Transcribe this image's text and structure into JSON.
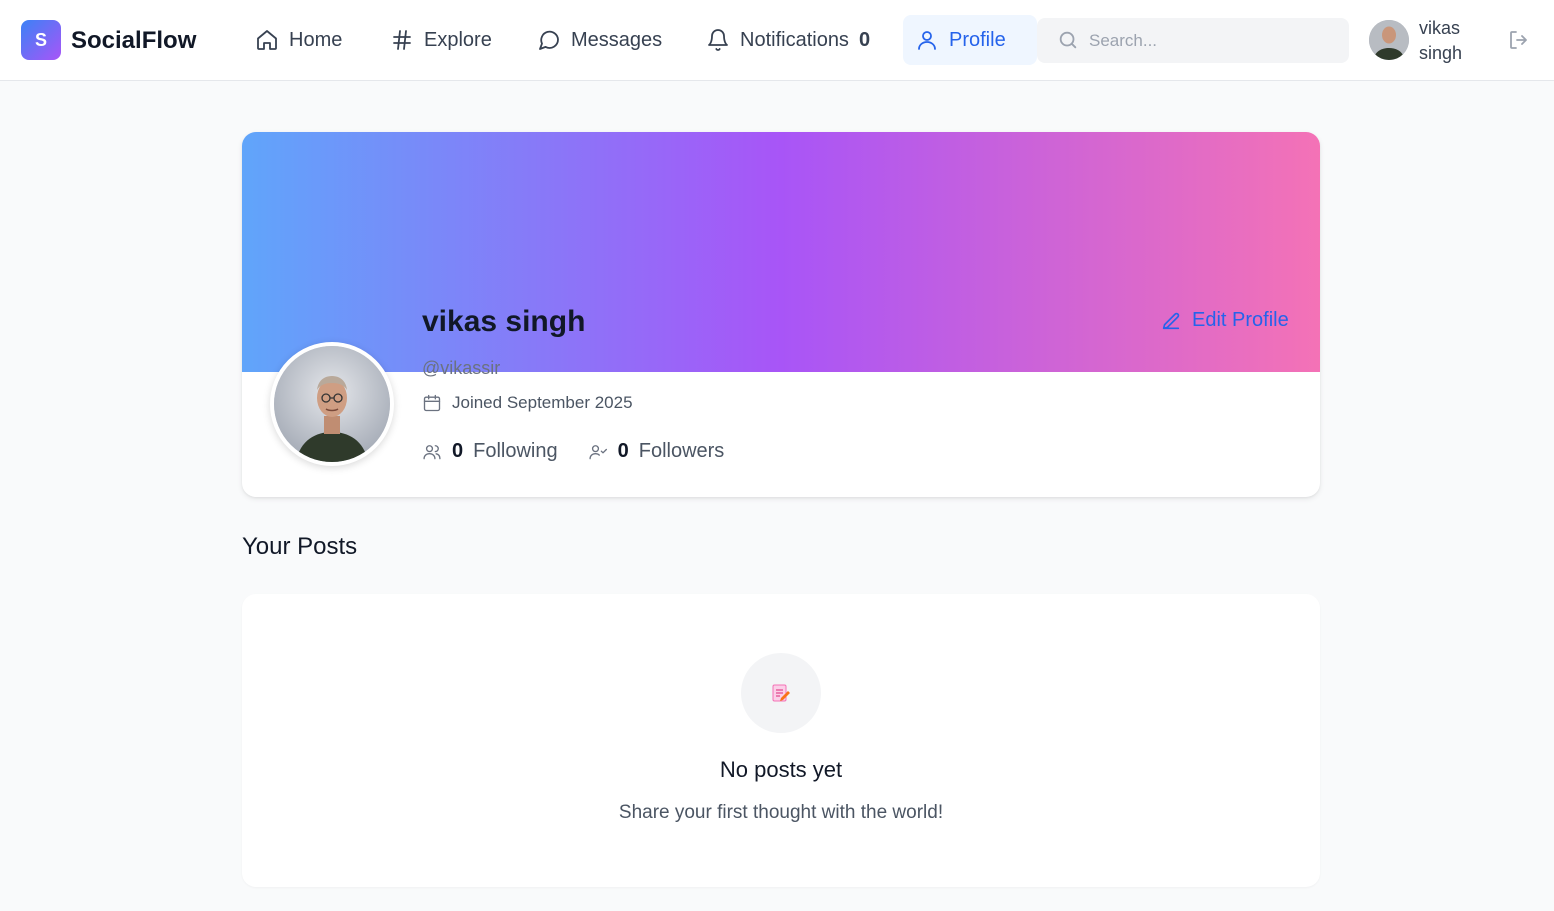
{
  "app": {
    "logo_letter": "S",
    "name": "SocialFlow"
  },
  "nav": {
    "items": [
      {
        "label": "Home",
        "icon": "home-icon"
      },
      {
        "label": "Explore",
        "icon": "hash-icon"
      },
      {
        "label": "Messages",
        "icon": "message-icon"
      },
      {
        "label": "Notifications",
        "icon": "bell-icon",
        "count": "0"
      },
      {
        "label": "Profile",
        "icon": "user-icon",
        "active": true
      }
    ]
  },
  "search": {
    "placeholder": "Search..."
  },
  "current_user": {
    "first": "vikas",
    "last": "singh"
  },
  "profile": {
    "name": "vikas singh",
    "handle": "@vikassir",
    "joined": "Joined September 2025",
    "following_count": "0",
    "following_label": "Following",
    "followers_count": "0",
    "followers_label": "Followers",
    "edit_label": "Edit Profile"
  },
  "posts": {
    "title": "Your Posts",
    "empty_title": "No posts yet",
    "empty_subtitle": "Share your first thought with the world!"
  },
  "colors": {
    "accent": "#2563eb",
    "cover_start": "#60a5fa",
    "cover_mid": "#a855f7",
    "cover_end": "#f472b6"
  }
}
